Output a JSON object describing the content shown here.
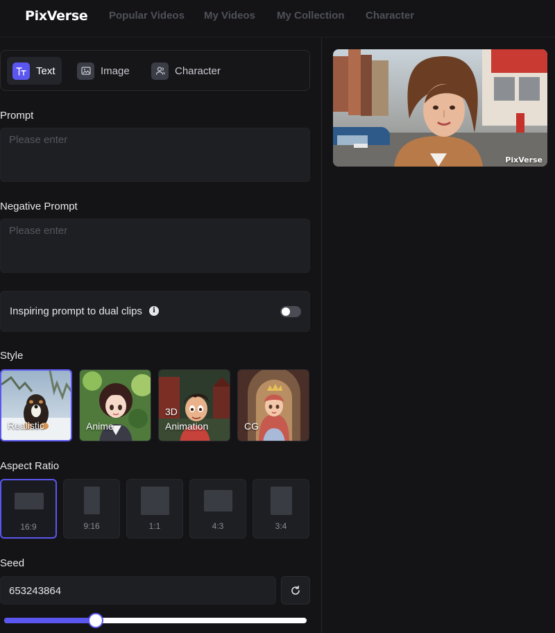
{
  "app": {
    "logo": "PixVerse"
  },
  "nav": [
    "Popular Videos",
    "My Videos",
    "My Collection",
    "Character"
  ],
  "modes": [
    {
      "label": "Text",
      "icon": "text-icon",
      "active": true
    },
    {
      "label": "Image",
      "icon": "image-icon",
      "active": false
    },
    {
      "label": "Character",
      "icon": "character-icon",
      "active": false
    }
  ],
  "prompt": {
    "label": "Prompt",
    "placeholder": "Please enter"
  },
  "negative_prompt": {
    "label": "Negative Prompt",
    "placeholder": "Please enter"
  },
  "inspiring": {
    "label": "Inspiring prompt to dual clips",
    "enabled": false
  },
  "style": {
    "label": "Style",
    "selected": "Realistic",
    "options": [
      "Realistic",
      "Anime",
      "3D\nAnimation",
      "CG"
    ]
  },
  "aspect_ratio": {
    "label": "Aspect Ratio",
    "selected": "16:9",
    "options": [
      "16:9",
      "9:16",
      "1:1",
      "4:3",
      "3:4"
    ]
  },
  "seed": {
    "label": "Seed",
    "value": "653243864",
    "slider_fraction": 0.303
  },
  "preview": {
    "watermark": "PixVerse"
  },
  "colors": {
    "accent": "#5b56f0",
    "background": "#141417",
    "panel": "#1e1f23"
  }
}
